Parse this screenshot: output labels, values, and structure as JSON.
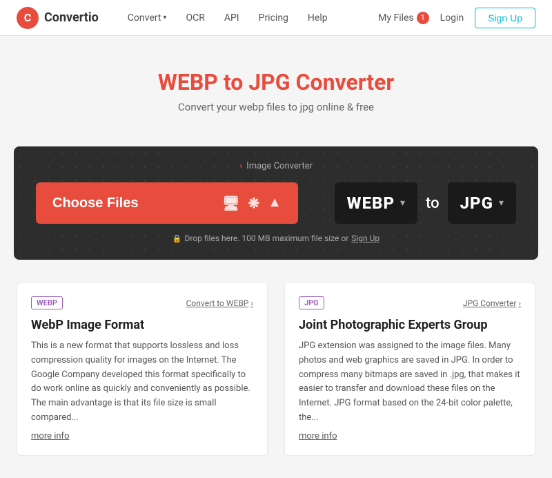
{
  "nav": {
    "logo_text": "Convertio",
    "links": [
      {
        "label": "Convert",
        "has_dropdown": true
      },
      {
        "label": "OCR",
        "has_dropdown": false
      },
      {
        "label": "API",
        "has_dropdown": false
      },
      {
        "label": "Pricing",
        "has_dropdown": false
      },
      {
        "label": "Help",
        "has_dropdown": false
      }
    ],
    "my_files_label": "My Files",
    "my_files_count": "1",
    "login_label": "Login",
    "signup_label": "Sign Up"
  },
  "hero": {
    "title": "WEBP to JPG Converter",
    "subtitle": "Convert your webp files to jpg online & free"
  },
  "converter": {
    "section_label": "Image Converter",
    "choose_files_label": "Choose Files",
    "from_format": "WEBP",
    "to_label": "to",
    "to_format": "JPG",
    "drop_hint": "Drop files here. 100 MB maximum file size or",
    "sign_up_link": "Sign Up"
  },
  "cards": [
    {
      "tag": "WEBP",
      "link_label": "Convert to WEBP",
      "title": "WebP Image Format",
      "desc": "This is a new format that supports lossless and loss compression quality for images on the Internet. The Google Company developed this format specifically to do work online as quickly and conveniently as possible. The main advantage is that its file size is small compared...",
      "more_info": "more info"
    },
    {
      "tag": "JPG",
      "link_label": "JPG Converter",
      "title": "Joint Photographic Experts Group",
      "desc": "JPG extension was assigned to the image files. Many photos and web graphics are saved in JPG. In order to compress many bitmaps are saved in .jpg, that makes it easier to transfer and download these files on the Internet. JPG format based on the 24-bit color palette, the...",
      "more_info": "more info"
    }
  ]
}
